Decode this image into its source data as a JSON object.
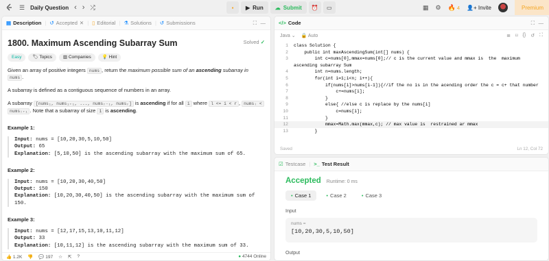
{
  "topbar": {
    "problem_list_label": "Daily Question",
    "run_label": "Run",
    "submit_label": "Submit",
    "streak_count": "4",
    "invite_label": "Invite",
    "premium_label": "Premium"
  },
  "desc_panel": {
    "tabs": [
      "Description",
      "Accepted",
      "Editorial",
      "Solutions",
      "Submissions"
    ],
    "title": "1800. Maximum Ascending Subarray Sum",
    "solved_label": "Solved",
    "chips": [
      "Easy",
      "Topics",
      "Companies",
      "Hint"
    ],
    "p1_a": "Given an array of positive integers ",
    "p1_code": "nums",
    "p1_b": ", return the ",
    "p1_i1": "maximum possible sum of an ",
    "p1_bold": "ascending",
    "p1_i2": " subarray in ",
    "p1_code2": "nums",
    "p1_end": ".",
    "p2": "A subarray is defined as a contiguous sequence of numbers in an array.",
    "p3_a": "A subarray ",
    "p3_code1": "[nums₁, nums₁₊₁, ..., numsᵣ₋₁, numsᵣ]",
    "p3_b": " is ",
    "p3_bold": "ascending",
    "p3_c": " if for all ",
    "p3_code2": "i",
    "p3_d": " where ",
    "p3_code3": "l <= i < r",
    "p3_e": ", ",
    "p3_code4": "numsᵢ <",
    "p3_code5": "numsᵢ₊₁",
    "p3_f": ". Note that a subarray of size ",
    "p3_code6": "1",
    "p3_g": " is ",
    "p3_bold2": "ascending",
    "p3_h": ".",
    "examples": [
      {
        "title": "Example 1:",
        "input": "nums = [10,20,30,5,10,50]",
        "output": "65",
        "explanation": "[5,10,50] is the ascending subarray with the maximum sum of 65."
      },
      {
        "title": "Example 2:",
        "input": "nums = [10,20,30,40,50]",
        "output": "150",
        "explanation": "[10,20,30,40,50] is the ascending subarray with the maximum sum of 150."
      },
      {
        "title": "Example 3:",
        "input": "nums = [12,17,15,13,10,11,12]",
        "output": "33",
        "explanation": "[10,11,12] is the ascending subarray with the maximum sum of 33."
      }
    ],
    "labels": {
      "input": "Input:",
      "output": "Output:",
      "explanation": "Explanation:"
    },
    "likes": "1.2K",
    "comments": "197",
    "online": "4744 Online"
  },
  "code_panel": {
    "tab": "Code",
    "language": "Java",
    "auto_label": "Auto",
    "saved": "Saved",
    "cursor_pos": "Ln 12, Col 72",
    "lines": [
      {
        "n": "1",
        "t": "class Solution {"
      },
      {
        "n": "2",
        "t": "    public int maxAscendingSum(int[] nums) {"
      },
      {
        "n": "3",
        "t": "        int c=nums[0],mmax=nums[0];// c is the current value and mmax is  the  maximum\nascending subarray Sum"
      },
      {
        "n": "4",
        "t": "        int n=nums.length;"
      },
      {
        "n": "5",
        "t": "        for(int i=1;i<n; i++){"
      },
      {
        "n": "6",
        "t": "            if(nums[i]>nums[i-1]){//if the no is in the acending order the c = c+ that number"
      },
      {
        "n": "7",
        "t": "                c+=nums[i];"
      },
      {
        "n": "8",
        "t": "            }"
      },
      {
        "n": "9",
        "t": "            else{ //else c is replace by the nums[i]"
      },
      {
        "n": "10",
        "t": "                c=nums[i];"
      },
      {
        "n": "11",
        "t": "            }"
      },
      {
        "n": "12",
        "t": "            mmax=Math.max(mmax,c); // max value is  restrained ar mmax"
      },
      {
        "n": "13",
        "t": "        }"
      }
    ]
  },
  "result_panel": {
    "tabs": [
      "Testcase",
      "Test Result"
    ],
    "status": "Accepted",
    "runtime": "Runtime: 0 ms",
    "cases": [
      "Case 1",
      "Case 2",
      "Case 3"
    ],
    "input_label": "Input",
    "var_name": "nums =",
    "input_value": "[10,20,30,5,10,50]",
    "output_label": "Output"
  },
  "colors": {
    "accent_green": "#2cbb5d",
    "premium_orange": "#f5a623",
    "easy_teal": "#00b8a3"
  }
}
